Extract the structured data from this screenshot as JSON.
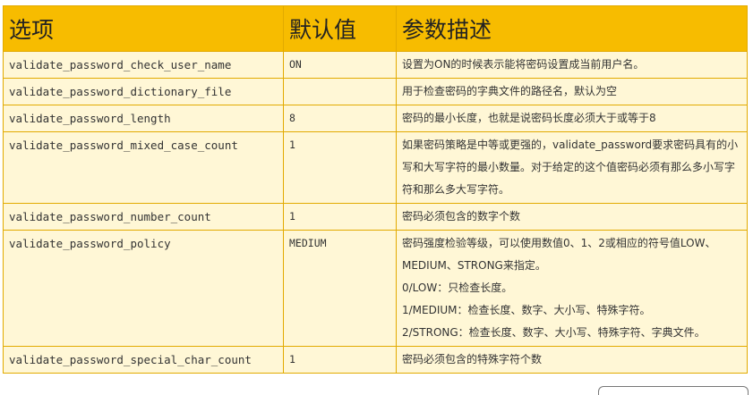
{
  "table": {
    "headers": {
      "option": "选项",
      "default": "默认值",
      "description": "参数描述"
    },
    "rows": [
      {
        "option": "validate_password_check_user_name",
        "default": "ON",
        "description": [
          "设置为ON的时候表示能将密码设置成当前用户名。"
        ]
      },
      {
        "option": "validate_password_dictionary_file",
        "default": "",
        "description": [
          "用于检查密码的字典文件的路径名，默认为空"
        ]
      },
      {
        "option": "validate_password_length",
        "default": "8",
        "description": [
          "密码的最小长度，也就是说密码长度必须大于或等于8"
        ]
      },
      {
        "option": "validate_password_mixed_case_count",
        "default": "1",
        "description": [
          "如果密码策略是中等或更强的，validate_password要求密码具有的小写和大写字符的最小数量。对于给定的这个值密码必须有那么多小写字符和那么多大写字符。"
        ]
      },
      {
        "option": "validate_password_number_count",
        "default": "1",
        "description": [
          "密码必须包含的数字个数"
        ]
      },
      {
        "option": "validate_password_policy",
        "default": "MEDIUM",
        "description": [
          "密码强度检验等级，可以使用数值0、1、2或相应的符号值LOW、MEDIUM、STRONG来指定。",
          "0/LOW：只检查长度。",
          "1/MEDIUM：检查长度、数字、大小写、特殊字符。",
          "2/STRONG：检查长度、数字、大小写、特殊字符、字典文件。"
        ]
      },
      {
        "option": "validate_password_special_char_count",
        "default": "1",
        "description": [
          "密码必须包含的特殊字符个数"
        ]
      }
    ]
  }
}
